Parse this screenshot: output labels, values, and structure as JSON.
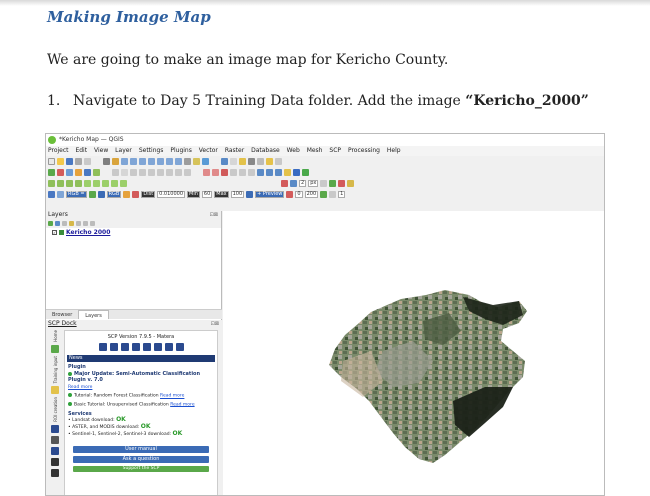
{
  "doc": {
    "heading": "Making Image Map",
    "paragraph": "We are going to make an image map for Kericho County.",
    "step_number": "1.",
    "step_text": "Navigate to Day 5 Training Data folder. Add the image ",
    "step_image_name": "“Kericho_2000”"
  },
  "qgis": {
    "window_title": "*Kericho Map — QGIS",
    "menu": [
      "Project",
      "Edit",
      "View",
      "Layer",
      "Settings",
      "Plugins",
      "Vector",
      "Raster",
      "Database",
      "Web",
      "Mesh",
      "SCP",
      "Processing",
      "Help"
    ],
    "toolbar_fields": {
      "rgb_select": "RGB =",
      "rgb2": "RGB",
      "zoom_field": "2",
      "unit": "px",
      "dist_label": "Dist",
      "dist_value": "0.010000",
      "min_label": "Min",
      "min_value": "60",
      "max_label": "Max",
      "max_value": "100",
      "preview": "+ Preview",
      "band_value": "0",
      "val_200": "200",
      "val_1": "1"
    },
    "layers_panel_title": "Layers",
    "layer_name": "Kericho 2000",
    "tabs": [
      "Browser",
      "Layers"
    ],
    "dock_title": "SCP Dock",
    "scp_version": "SCP Version 7.9.5 - Matera",
    "news_label": "News",
    "plugin_heading": "Plugin",
    "major_update": "Major Update: Semi-Automatic Classification Plugin v. 7.0",
    "read_more": "Read more",
    "tutorial1": "Tutorial: Random Forest Classification",
    "tutorial2": "Basic Tutorial: Unsupervised Classification",
    "services_heading": "Services",
    "svc1": "Landsat download:",
    "svc2": "ASTER, and MODIS download:",
    "svc3": "Sentinel-1, Sentinel-2, Sentinel-3 download:",
    "ok": "OK",
    "sidebar_labels": [
      "Home",
      "Training input",
      "ROI creation"
    ],
    "btn_manual": "User manual",
    "btn_question": "Ask a question",
    "btn_support": "Support the SCP"
  },
  "colors": {
    "heading": "#2e5f9e",
    "scp_blue": "#1f3a73",
    "ok_green": "#2a9a2a"
  }
}
